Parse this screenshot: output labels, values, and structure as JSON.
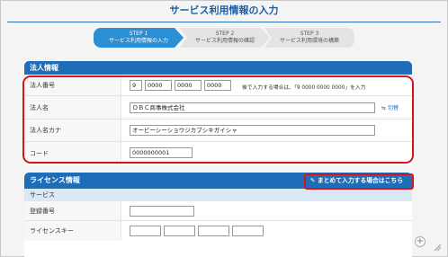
{
  "page": {
    "title": "サービス利用情報の入力"
  },
  "steps": [
    {
      "num": "STEP 1",
      "label": "サービス利用情報の入力"
    },
    {
      "num": "STEP 2",
      "label": "サービス利用情報の確認"
    },
    {
      "num": "STEP 3",
      "label": "サービス利用環境の構築"
    }
  ],
  "corp": {
    "heading": "法人情報",
    "number_label": "法人番号",
    "number_values": [
      "9",
      "0000",
      "0000",
      "0000"
    ],
    "number_hint": "後で入力する場合は、「9 0000 0000 0000」を入力",
    "name_label": "法人名",
    "name_value": "ＯＢＣ商事株式会社",
    "swap_label": "切替",
    "kana_label": "法人名カナ",
    "kana_value": "オービーシーショウジカブシキガイシャ",
    "code_label": "コード",
    "code_value": "0000000001"
  },
  "license": {
    "heading": "ライセンス情報",
    "bulk_button": "まとめて入力する場合はこちら",
    "service_label": "サービス",
    "reg_label": "登録番号",
    "key_label": "ライセンスキー"
  },
  "colors": {
    "accent": "#1e6db8",
    "highlight": "#d7141b"
  }
}
